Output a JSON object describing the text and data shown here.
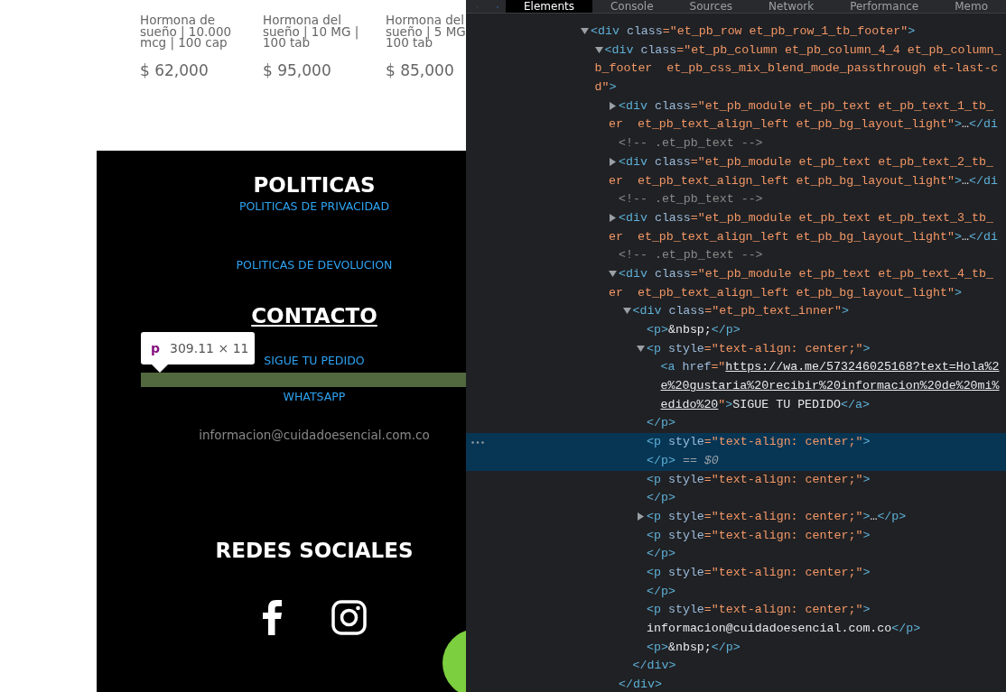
{
  "site": {
    "products": [
      {
        "name_lines": [
          "Hormona de",
          "sueño | 10.000",
          "mcg | 100 cap"
        ],
        "price": "$ 62,000"
      },
      {
        "name_lines": [
          "Hormona del",
          "sueño | 10 MG |",
          "100 tab"
        ],
        "price": "$ 95,000"
      },
      {
        "name_lines": [
          "Hormona del",
          "sueño | 5 MG",
          "100 tab"
        ],
        "price": "$ 85,000"
      }
    ],
    "footer": {
      "policies_heading": "POLITICAS",
      "policy_links": [
        "POLITICAS DE PRIVACIDAD",
        "POLITICAS DE DEVOLUCION"
      ],
      "contact_heading": "CONTACTO",
      "contact_links": [
        "SIGUE TU PEDIDO",
        "WHATSAPP"
      ],
      "email": "informacion@cuidadoesencial.com.co",
      "social_heading": "REDES SOCIALES"
    },
    "inspector_tooltip": {
      "tag": "p",
      "size": "309.11 × 11"
    }
  },
  "devtools": {
    "tabs": [
      {
        "label": "Elements",
        "selected": true
      },
      {
        "label": "Console",
        "selected": false
      },
      {
        "label": "Sources",
        "selected": false
      },
      {
        "label": "Network",
        "selected": false
      },
      {
        "label": "Performance",
        "selected": false
      },
      {
        "label": "Memo",
        "selected": false
      }
    ],
    "tree": [
      {
        "expanded": true,
        "selected": false,
        "lines": [
          [
            {
              "kind": "tag",
              "text": "<div"
            },
            {
              "kind": "attr",
              "text": " class"
            },
            {
              "kind": "value",
              "text": "=\"et_pb_row et_pb_row_1_tb_footer\""
            },
            {
              "kind": "tag",
              "text": ">"
            }
          ]
        ],
        "children": [
          {
            "expanded": true,
            "selected": false,
            "lines": [
              [
                {
                  "kind": "tag",
                  "text": "<div"
                },
                {
                  "kind": "attr",
                  "text": " class"
                },
                {
                  "kind": "value",
                  "text": "=\"et_pb_column et_pb_column_4_4 et_pb_column_"
                }
              ],
              [
                {
                  "kind": "value",
                  "text": "b_footer  et_pb_css_mix_blend_mode_passthrough et-last-c"
                }
              ],
              [
                {
                  "kind": "value",
                  "text": "d\""
                },
                {
                  "kind": "tag",
                  "text": ">"
                }
              ]
            ],
            "children": [
              {
                "expanded": false,
                "selected": false,
                "lines": [
                  [
                    {
                      "kind": "tag",
                      "text": "<div"
                    },
                    {
                      "kind": "attr",
                      "text": " class"
                    },
                    {
                      "kind": "value",
                      "text": "=\"et_pb_module et_pb_text et_pb_text_1_tb_"
                    }
                  ],
                  [
                    {
                      "kind": "value",
                      "text": "er  et_pb_text_align_left et_pb_bg_layout_light\""
                    },
                    {
                      "kind": "tag",
                      "text": ">"
                    },
                    {
                      "kind": "text",
                      "text": "…"
                    },
                    {
                      "kind": "tag",
                      "text": "</di"
                    }
                  ]
                ]
              },
              {
                "selected": false,
                "lines": [
                  [
                    {
                      "kind": "comment",
                      "text": "<!-- .et_pb_text -->"
                    }
                  ]
                ]
              },
              {
                "expanded": false,
                "selected": false,
                "lines": [
                  [
                    {
                      "kind": "tag",
                      "text": "<div"
                    },
                    {
                      "kind": "attr",
                      "text": " class"
                    },
                    {
                      "kind": "value",
                      "text": "=\"et_pb_module et_pb_text et_pb_text_2_tb_"
                    }
                  ],
                  [
                    {
                      "kind": "value",
                      "text": "er  et_pb_text_align_left et_pb_bg_layout_light\""
                    },
                    {
                      "kind": "tag",
                      "text": ">"
                    },
                    {
                      "kind": "text",
                      "text": "…"
                    },
                    {
                      "kind": "tag",
                      "text": "</di"
                    }
                  ]
                ]
              },
              {
                "selected": false,
                "lines": [
                  [
                    {
                      "kind": "comment",
                      "text": "<!-- .et_pb_text -->"
                    }
                  ]
                ]
              },
              {
                "expanded": false,
                "selected": false,
                "lines": [
                  [
                    {
                      "kind": "tag",
                      "text": "<div"
                    },
                    {
                      "kind": "attr",
                      "text": " class"
                    },
                    {
                      "kind": "value",
                      "text": "=\"et_pb_module et_pb_text et_pb_text_3_tb_"
                    }
                  ],
                  [
                    {
                      "kind": "value",
                      "text": "er  et_pb_text_align_left et_pb_bg_layout_light\""
                    },
                    {
                      "kind": "tag",
                      "text": ">"
                    },
                    {
                      "kind": "text",
                      "text": "…"
                    },
                    {
                      "kind": "tag",
                      "text": "</di"
                    }
                  ]
                ]
              },
              {
                "selected": false,
                "lines": [
                  [
                    {
                      "kind": "comment",
                      "text": "<!-- .et_pb_text -->"
                    }
                  ]
                ]
              },
              {
                "expanded": true,
                "selected": false,
                "lines": [
                  [
                    {
                      "kind": "tag",
                      "text": "<div"
                    },
                    {
                      "kind": "attr",
                      "text": " class"
                    },
                    {
                      "kind": "value",
                      "text": "=\"et_pb_module et_pb_text et_pb_text_4_tb_"
                    }
                  ],
                  [
                    {
                      "kind": "value",
                      "text": "er  et_pb_text_align_left et_pb_bg_layout_light\""
                    },
                    {
                      "kind": "tag",
                      "text": ">"
                    }
                  ]
                ],
                "closing": [
                  [
                    {
                      "kind": "tag",
                      "text": "</div>"
                    }
                  ]
                ],
                "children": [
                  {
                    "expanded": true,
                    "selected": false,
                    "lines": [
                      [
                        {
                          "kind": "tag",
                          "text": "<div"
                        },
                        {
                          "kind": "attr",
                          "text": " class"
                        },
                        {
                          "kind": "value",
                          "text": "=\"et_pb_text_inner\""
                        },
                        {
                          "kind": "tag",
                          "text": ">"
                        }
                      ]
                    ],
                    "closing": [
                      [
                        {
                          "kind": "tag",
                          "text": "</div>"
                        }
                      ]
                    ],
                    "children": [
                      {
                        "selected": false,
                        "lines": [
                          [
                            {
                              "kind": "tag",
                              "text": "<p>"
                            },
                            {
                              "kind": "text",
                              "text": "&nbsp;"
                            },
                            {
                              "kind": "tag",
                              "text": "</p>"
                            }
                          ]
                        ]
                      },
                      {
                        "expanded": true,
                        "selected": false,
                        "lines": [
                          [
                            {
                              "kind": "tag",
                              "text": "<p"
                            },
                            {
                              "kind": "attr",
                              "text": " style"
                            },
                            {
                              "kind": "value",
                              "text": "=\"text-align: center;\""
                            },
                            {
                              "kind": "tag",
                              "text": ">"
                            }
                          ]
                        ],
                        "closing": [
                          [
                            {
                              "kind": "tag",
                              "text": "</p>"
                            }
                          ]
                        ],
                        "children": [
                          {
                            "selected": false,
                            "lines": [
                              [
                                {
                                  "kind": "tag",
                                  "text": "<a"
                                },
                                {
                                  "kind": "attr",
                                  "text": " href"
                                },
                                {
                                  "kind": "value",
                                  "text": "=\""
                                },
                                {
                                  "kind": "link",
                                  "text": "https://wa.me/573246025168?text=Hola%2"
                                }
                              ],
                              [
                                {
                                  "kind": "link",
                                  "text": "e%20gustaria%20recibir%20informacion%20de%20mi%"
                                }
                              ],
                              [
                                {
                                  "kind": "link",
                                  "text": "edido%20"
                                },
                                {
                                  "kind": "value",
                                  "text": "\""
                                },
                                {
                                  "kind": "tag",
                                  "text": ">"
                                },
                                {
                                  "kind": "text",
                                  "text": "SIGUE TU PEDIDO"
                                },
                                {
                                  "kind": "tag",
                                  "text": "</a>"
                                }
                              ]
                            ]
                          }
                        ]
                      },
                      {
                        "selected": true,
                        "lines": [
                          [
                            {
                              "kind": "tag",
                              "text": "<p"
                            },
                            {
                              "kind": "attr",
                              "text": " style"
                            },
                            {
                              "kind": "value",
                              "text": "=\"text-align: center;\""
                            },
                            {
                              "kind": "tag",
                              "text": ">"
                            }
                          ],
                          [
                            {
                              "kind": "tag",
                              "text": "</p>"
                            },
                            {
                              "kind": "dim",
                              "text": " == $0"
                            }
                          ]
                        ]
                      },
                      {
                        "selected": false,
                        "lines": [
                          [
                            {
                              "kind": "tag",
                              "text": "<p"
                            },
                            {
                              "kind": "attr",
                              "text": " style"
                            },
                            {
                              "kind": "value",
                              "text": "=\"text-align: center;\""
                            },
                            {
                              "kind": "tag",
                              "text": ">"
                            }
                          ],
                          [
                            {
                              "kind": "tag",
                              "text": "</p>"
                            }
                          ]
                        ]
                      },
                      {
                        "expanded": false,
                        "selected": false,
                        "lines": [
                          [
                            {
                              "kind": "tag",
                              "text": "<p"
                            },
                            {
                              "kind": "attr",
                              "text": " style"
                            },
                            {
                              "kind": "value",
                              "text": "=\"text-align: center;\""
                            },
                            {
                              "kind": "tag",
                              "text": ">"
                            },
                            {
                              "kind": "text",
                              "text": "…"
                            },
                            {
                              "kind": "tag",
                              "text": "</p>"
                            }
                          ]
                        ]
                      },
                      {
                        "selected": false,
                        "lines": [
                          [
                            {
                              "kind": "tag",
                              "text": "<p"
                            },
                            {
                              "kind": "attr",
                              "text": " style"
                            },
                            {
                              "kind": "value",
                              "text": "=\"text-align: center;\""
                            },
                            {
                              "kind": "tag",
                              "text": ">"
                            }
                          ],
                          [
                            {
                              "kind": "tag",
                              "text": "</p>"
                            }
                          ]
                        ]
                      },
                      {
                        "selected": false,
                        "lines": [
                          [
                            {
                              "kind": "tag",
                              "text": "<p"
                            },
                            {
                              "kind": "attr",
                              "text": " style"
                            },
                            {
                              "kind": "value",
                              "text": "=\"text-align: center;\""
                            },
                            {
                              "kind": "tag",
                              "text": ">"
                            }
                          ],
                          [
                            {
                              "kind": "tag",
                              "text": "</p>"
                            }
                          ]
                        ]
                      },
                      {
                        "selected": false,
                        "lines": [
                          [
                            {
                              "kind": "tag",
                              "text": "<p"
                            },
                            {
                              "kind": "attr",
                              "text": " style"
                            },
                            {
                              "kind": "value",
                              "text": "=\"text-align: center;\""
                            },
                            {
                              "kind": "tag",
                              "text": ">"
                            }
                          ],
                          [
                            {
                              "kind": "text",
                              "text": "informacion@cuidadoesencial.com.co"
                            },
                            {
                              "kind": "tag",
                              "text": "</p>"
                            }
                          ]
                        ]
                      },
                      {
                        "selected": false,
                        "lines": [
                          [
                            {
                              "kind": "tag",
                              "text": "<p>"
                            },
                            {
                              "kind": "text",
                              "text": "&nbsp;"
                            },
                            {
                              "kind": "tag",
                              "text": "</p>"
                            }
                          ]
                        ]
                      }
                    ]
                  }
                ]
              }
            ]
          }
        ]
      }
    ]
  }
}
